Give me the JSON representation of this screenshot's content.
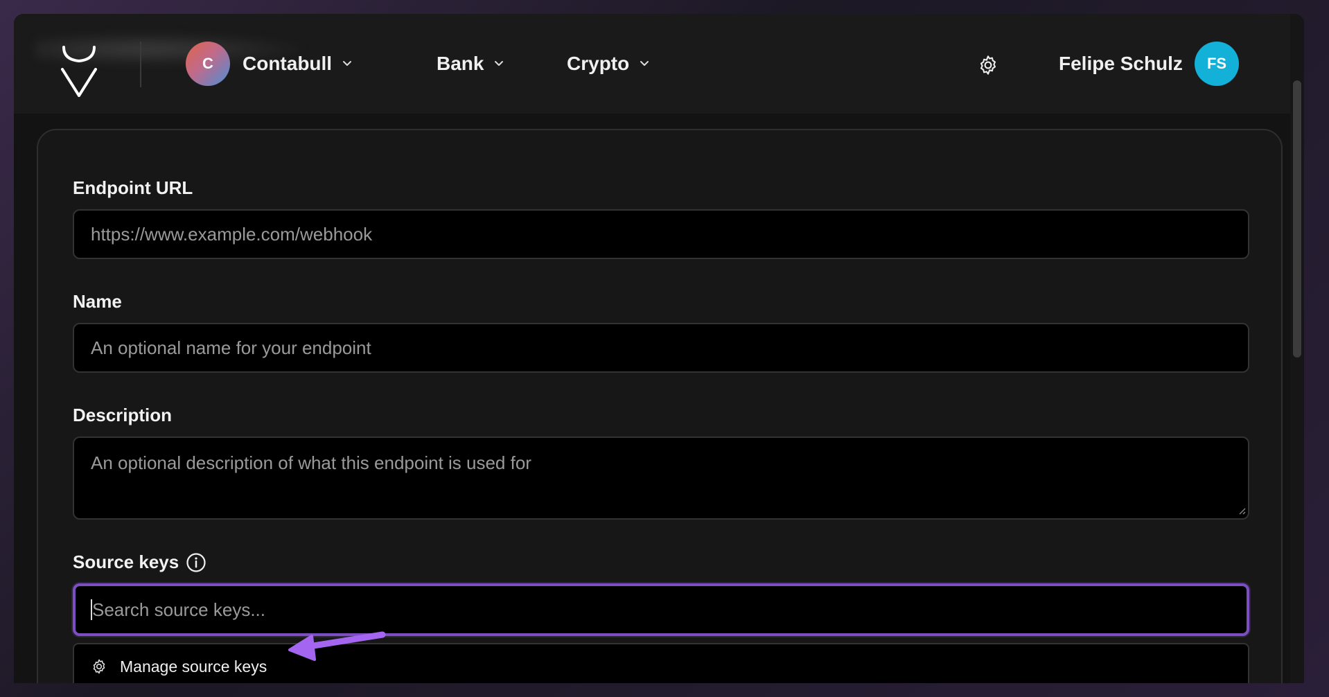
{
  "topbar": {
    "org": {
      "initial": "C",
      "name": "Contabull"
    },
    "menus": [
      {
        "label": "Bank"
      },
      {
        "label": "Crypto"
      }
    ],
    "user": {
      "name": "Felipe Schulz",
      "initials": "FS"
    }
  },
  "form": {
    "endpoint_url": {
      "label": "Endpoint URL",
      "placeholder": "https://www.example.com/webhook",
      "value": ""
    },
    "name": {
      "label": "Name",
      "placeholder": "An optional name for your endpoint",
      "value": ""
    },
    "description": {
      "label": "Description",
      "placeholder": "An optional description of what this endpoint is used for",
      "value": ""
    },
    "source_keys": {
      "label": "Source keys",
      "search_placeholder": "Search source keys...",
      "manage_label": "Manage source keys"
    }
  },
  "colors": {
    "focus_ring": "#7b4fc0",
    "arrow": "#a466f0",
    "user_avatar": "#13b0d8"
  }
}
